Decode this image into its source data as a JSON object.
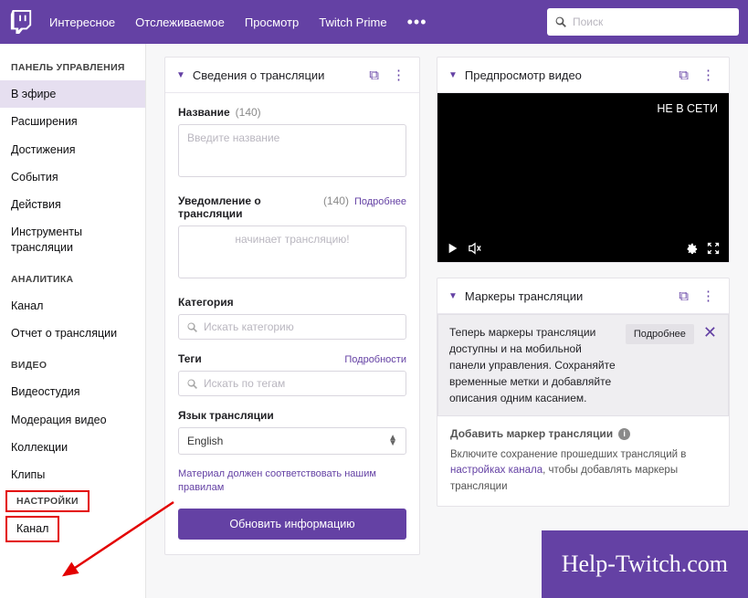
{
  "topnav": {
    "items": [
      "Интересное",
      "Отслеживаемое",
      "Просмотр",
      "Twitch Prime"
    ],
    "search_placeholder": "Поиск"
  },
  "sidebar": {
    "dashboard": {
      "title": "ПАНЕЛЬ УПРАВЛЕНИЯ",
      "items": [
        "В эфире",
        "Расширения",
        "Достижения",
        "События",
        "Действия",
        "Инструменты трансляции"
      ]
    },
    "analytics": {
      "title": "АНАЛИТИКА",
      "items": [
        "Канал",
        "Отчет о трансляции"
      ]
    },
    "video": {
      "title": "ВИДЕО",
      "items": [
        "Видеостудия",
        "Модерация видео",
        "Коллекции",
        "Клипы"
      ]
    },
    "settings": {
      "title": "НАСТРОЙКИ",
      "items": [
        "Канал"
      ]
    }
  },
  "stream_info": {
    "panel_title": "Сведения о трансляции",
    "title_label": "Название",
    "title_count": "(140)",
    "title_placeholder": "Введите название",
    "notif_label": "Уведомление о трансляции",
    "notif_count": "(140)",
    "notif_link": "Подробнее",
    "notif_placeholder": "начинает трансляцию!",
    "category_label": "Категория",
    "category_placeholder": "Искать категорию",
    "tags_label": "Теги",
    "tags_link": "Подробности",
    "tags_placeholder": "Искать по тегам",
    "lang_label": "Язык трансляции",
    "lang_value": "English",
    "disclaimer": "Материал должен соответствовать нашим правилам",
    "update_btn": "Обновить информацию"
  },
  "preview": {
    "panel_title": "Предпросмотр видео",
    "status": "НЕ В СЕТИ"
  },
  "markers": {
    "panel_title": "Маркеры трансляции",
    "banner_text": "Теперь маркеры трансляции доступны и на мобильной панели управления. Сохраняйте временные метки и добавляйте описания одним касанием.",
    "banner_more": "Подробнее",
    "add_label": "Добавить маркер трансляции",
    "hint_pre": "Включите сохранение прошедших трансляций в ",
    "hint_link": "настройках канала",
    "hint_post": ", чтобы добавлять маркеры трансляции"
  },
  "watermark": "Help-Twitch.com"
}
